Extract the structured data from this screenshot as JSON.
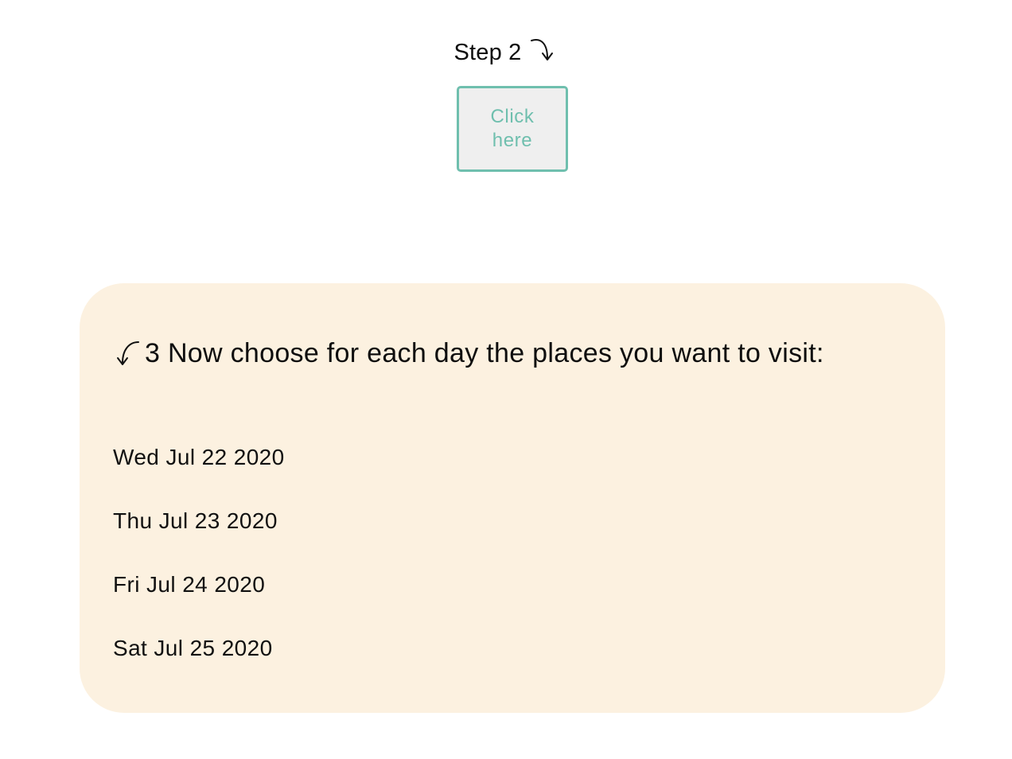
{
  "step": {
    "label": "Step 2",
    "arrow_icon": "curved-arrow-down-right-icon"
  },
  "action_button": {
    "label": "Click here",
    "border_color": "#6fbfae",
    "text_color": "#6fbfae",
    "background": "#efefef"
  },
  "card": {
    "heading": "3 Now choose for each day the places you want to visit:",
    "arrow_icon": "curved-arrow-down-left-icon",
    "background": "#fcf1e0",
    "days": [
      {
        "label": "Wed Jul 22 2020"
      },
      {
        "label": "Thu Jul 23 2020"
      },
      {
        "label": "Fri Jul 24 2020"
      },
      {
        "label": "Sat Jul 25 2020"
      }
    ]
  }
}
